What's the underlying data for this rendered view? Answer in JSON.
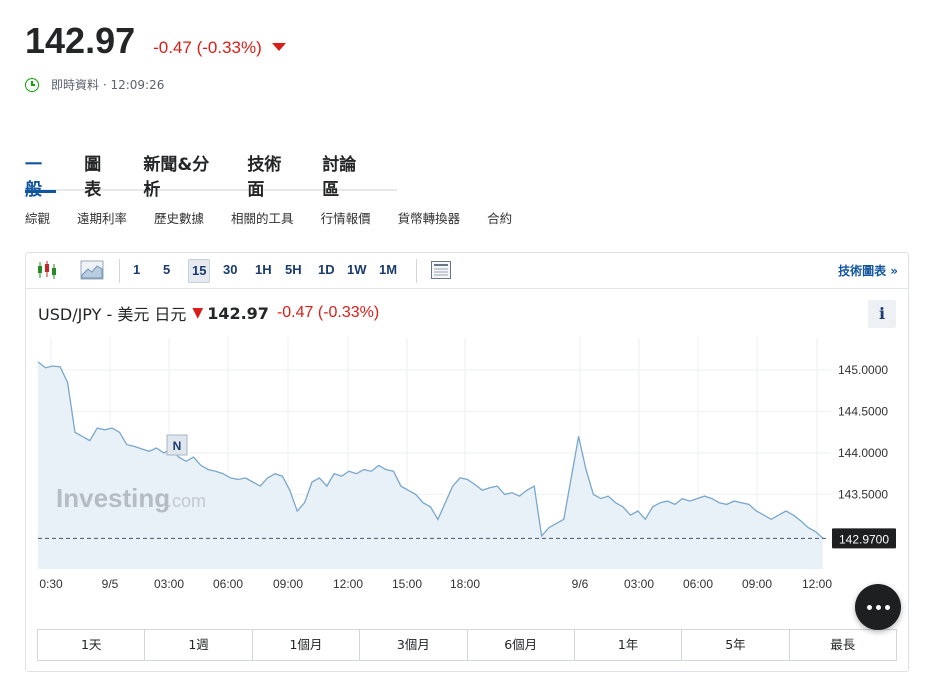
{
  "quote": {
    "price": "142.97",
    "change": "-0.47",
    "change_pct": "(-0.33%)",
    "realtime_label": "即時資料 · 12:09:26"
  },
  "tabs": [
    {
      "label": "一般",
      "active": true
    },
    {
      "label": "圖表",
      "active": false
    },
    {
      "label": "新聞&分析",
      "active": false
    },
    {
      "label": "技術面",
      "active": false
    },
    {
      "label": "討論區",
      "active": false
    }
  ],
  "subnav": [
    "綜觀",
    "遠期利率",
    "歷史數據",
    "相關的工具",
    "行情報價",
    "貨幣轉換器",
    "合約"
  ],
  "toolbar": {
    "intervals": [
      "1",
      "5",
      "15",
      "30",
      "1H",
      "5H",
      "1D",
      "1W",
      "1M"
    ],
    "selected_interval": "15",
    "tech_chart_link": "技術圖表 »"
  },
  "symbol": {
    "name": "USD/JPY - 美元 日元",
    "arrow": "🡇",
    "price": "142.97",
    "change": "-0.47",
    "change_pct": "(-0.33%)",
    "info": "i"
  },
  "chart_data": {
    "type": "area",
    "watermark": "Investing",
    "watermark_suffix": ".com",
    "news_marker": "N",
    "current_value_label": "142.9700",
    "current_value": 142.97,
    "ylim": [
      142.6,
      145.4
    ],
    "yticks": [
      "145.0000",
      "144.5000",
      "144.0000",
      "143.5000"
    ],
    "ytick_values": [
      145.0,
      144.5,
      144.0,
      143.5
    ],
    "xticks": [
      "0:30",
      "9/5",
      "03:00",
      "06:00",
      "09:00",
      "12:00",
      "15:00",
      "18:00",
      "9/6",
      "03:00",
      "06:00",
      "09:00",
      "12:00"
    ],
    "values": [
      145.1,
      145.03,
      145.05,
      145.04,
      144.85,
      144.25,
      144.2,
      144.15,
      144.3,
      144.28,
      144.3,
      144.25,
      144.1,
      144.08,
      144.05,
      144.02,
      144.06,
      144.0,
      144.05,
      143.95,
      143.9,
      143.95,
      143.85,
      143.8,
      143.78,
      143.75,
      143.7,
      143.68,
      143.7,
      143.65,
      143.6,
      143.7,
      143.75,
      143.72,
      143.55,
      143.3,
      143.4,
      143.65,
      143.7,
      143.6,
      143.75,
      143.72,
      143.78,
      143.75,
      143.8,
      143.78,
      143.85,
      143.8,
      143.78,
      143.6,
      143.55,
      143.5,
      143.4,
      143.35,
      143.2,
      143.4,
      143.6,
      143.7,
      143.68,
      143.62,
      143.55,
      143.58,
      143.6,
      143.5,
      143.52,
      143.48,
      143.55,
      143.6,
      143.0,
      143.1,
      143.15,
      143.2,
      143.7,
      144.2,
      143.8,
      143.5,
      143.45,
      143.48,
      143.4,
      143.35,
      143.25,
      143.3,
      143.2,
      143.35,
      143.4,
      143.42,
      143.38,
      143.45,
      143.42,
      143.45,
      143.48,
      143.45,
      143.4,
      143.38,
      143.42,
      143.4,
      143.38,
      143.3,
      143.25,
      143.2,
      143.25,
      143.3,
      143.25,
      143.18,
      143.1,
      143.05,
      142.97
    ],
    "news_marker_at": 0.25,
    "colors": {
      "line": "#7aa7cc",
      "fill": "#e8f0f8",
      "dash": "#4a5563",
      "label_bg": "#1e1f21"
    }
  },
  "ranges": [
    "1天",
    "1週",
    "1個月",
    "3個月",
    "6個月",
    "1年",
    "5年",
    "最長"
  ],
  "colors": {
    "accent": "#1256a0",
    "negative": "#d91e18",
    "positive": "#0ea600"
  }
}
